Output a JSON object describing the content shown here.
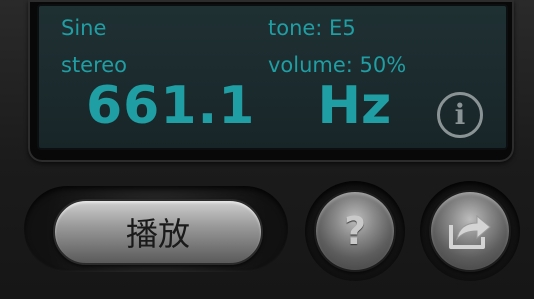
{
  "display": {
    "waveform": "Sine",
    "tone": "tone:  E5",
    "channel_mode": "stereo",
    "volume": "volume: 50%",
    "frequency_value": "661.1",
    "frequency_unit": "Hz",
    "info_glyph": "i"
  },
  "controls": {
    "play_label": "播放",
    "help_glyph": "?",
    "share_icon": "share-icon"
  },
  "colors": {
    "lcd_text": "#1f9ea3",
    "lcd_background": "#1c2c2f",
    "body": "#1b1b1b"
  }
}
